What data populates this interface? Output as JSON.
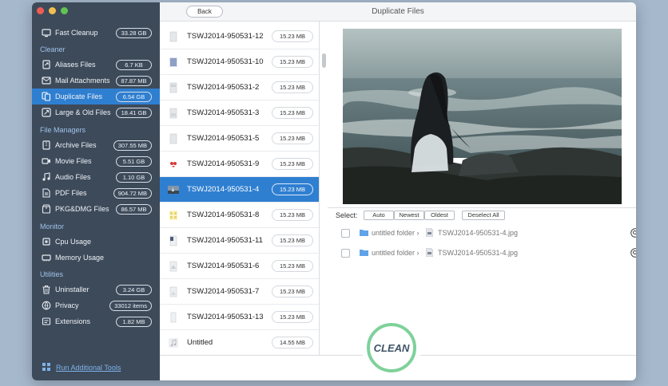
{
  "window": {
    "title": "Duplicate Files",
    "back_label": "Back"
  },
  "sidebar": {
    "top_item": {
      "label": "Fast Cleanup",
      "badge": "33.28 GB",
      "icon": "monitor-icon"
    },
    "sections": {
      "cleaner": "Cleaner",
      "file_managers": "File Managers",
      "monitor": "Monitor",
      "utilities": "Utilities"
    },
    "cleaner_items": [
      {
        "label": "Aliases Files",
        "badge": "6.7 KB",
        "icon": "alias-icon"
      },
      {
        "label": "Mail Attachments",
        "badge": "87.87 MB",
        "icon": "mail-icon"
      },
      {
        "label": "Duplicate Files",
        "badge": "6.54 GB",
        "icon": "duplicate-icon"
      },
      {
        "label": "Large & Old Files",
        "badge": "18.41 GB",
        "icon": "large-files-icon"
      }
    ],
    "file_manager_items": [
      {
        "label": "Archive Files",
        "badge": "307.55 MB",
        "icon": "archive-icon"
      },
      {
        "label": "Movie Files",
        "badge": "5.51 GB",
        "icon": "movie-icon"
      },
      {
        "label": "Audio Files",
        "badge": "1.10 GB",
        "icon": "audio-icon"
      },
      {
        "label": "PDF Files",
        "badge": "904.72 MB",
        "icon": "pdf-icon"
      },
      {
        "label": "PKG&DMG Files",
        "badge": "86.57 MB",
        "icon": "package-icon"
      }
    ],
    "monitor_items": [
      {
        "label": "Cpu Usage",
        "icon": "cpu-icon"
      },
      {
        "label": "Memory Usage",
        "icon": "memory-icon"
      }
    ],
    "utility_items": [
      {
        "label": "Uninstaller",
        "badge": "3.24 GB",
        "icon": "trash-icon"
      },
      {
        "label": "Privacy",
        "badge": "33012 items",
        "icon": "privacy-icon"
      },
      {
        "label": "Extensions",
        "badge": "1.82 MB",
        "icon": "extensions-icon"
      }
    ],
    "run_tools_label": "Run Additional Tools"
  },
  "files": [
    {
      "name": "TSWJ2014-950531-12",
      "size": "15.23 MB"
    },
    {
      "name": "TSWJ2014-950531-10",
      "size": "15.23 MB"
    },
    {
      "name": "TSWJ2014-950531-2",
      "size": "15.23 MB"
    },
    {
      "name": "TSWJ2014-950531-3",
      "size": "15.23 MB"
    },
    {
      "name": "TSWJ2014-950531-5",
      "size": "15.23 MB"
    },
    {
      "name": "TSWJ2014-950531-9",
      "size": "15.23 MB"
    },
    {
      "name": "TSWJ2014-950531-4",
      "size": "15.23 MB"
    },
    {
      "name": "TSWJ2014-950531-8",
      "size": "15.23 MB"
    },
    {
      "name": "TSWJ2014-950531-11",
      "size": "15.23 MB"
    },
    {
      "name": "TSWJ2014-950531-6",
      "size": "15.23 MB"
    },
    {
      "name": "TSWJ2014-950531-7",
      "size": "15.23 MB"
    },
    {
      "name": "TSWJ2014-950531-13",
      "size": "15.23 MB"
    },
    {
      "name": "Untitled",
      "size": "14.55 MB"
    }
  ],
  "select_bar": {
    "label": "Select:",
    "auto": "Auto",
    "newest": "Newest",
    "oldest": "Oldest",
    "deselect_all": "Deselect All"
  },
  "duplicates": [
    {
      "folder": "untitled folder",
      "file": "TSWJ2014-950531-4.jpg"
    },
    {
      "folder": "untitled folder",
      "file": "TSWJ2014-950531-4.jpg"
    }
  ],
  "clean_label": "CLEAN",
  "colors": {
    "sidebar_bg": "#3d4a5a",
    "accent": "#2f7fd1",
    "clean_ring": "#7fd19b"
  }
}
